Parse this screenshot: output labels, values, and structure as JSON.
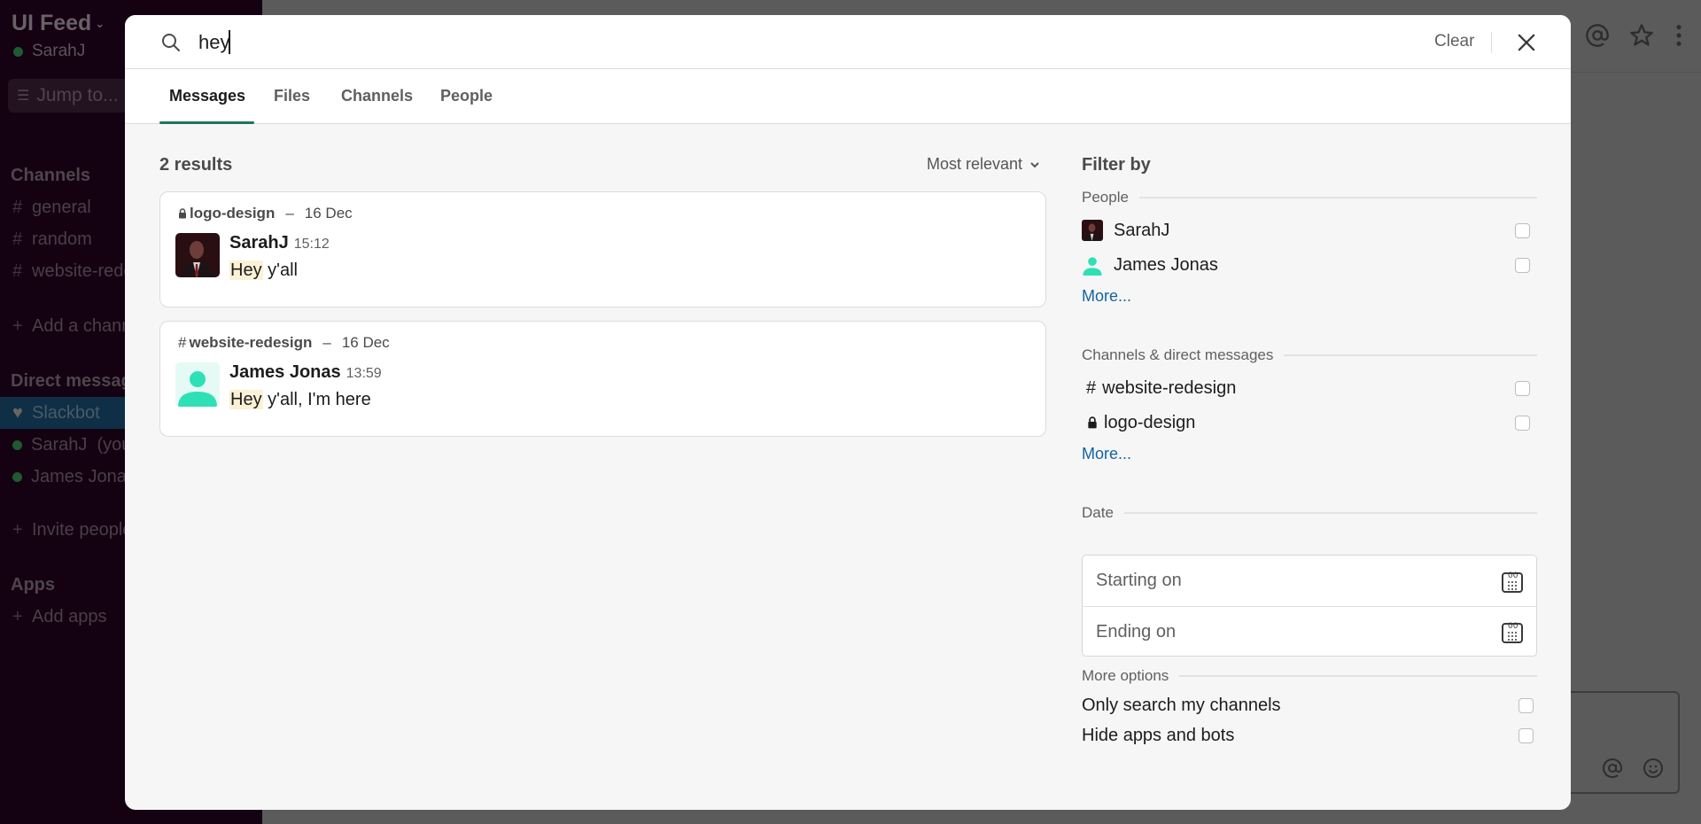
{
  "sidebar": {
    "workspace": "UI Feed",
    "user": "SarahJ",
    "jump_to": "Jump to...",
    "channels_header": "Channels",
    "channels": [
      "general",
      "random",
      "website-redesign"
    ],
    "add_channel": "Add a channel",
    "dm_header": "Direct messages",
    "dms": [
      {
        "name": "Slackbot",
        "suffix": ""
      },
      {
        "name": "SarahJ",
        "suffix": "(you)"
      },
      {
        "name": "James Jonas",
        "suffix": ""
      }
    ],
    "invite": "Invite people",
    "apps_header": "Apps",
    "add_apps": "Add apps"
  },
  "search": {
    "query": "hey",
    "clear_label": "Clear"
  },
  "tabs": [
    {
      "label": "Messages",
      "active": true
    },
    {
      "label": "Files",
      "active": false
    },
    {
      "label": "Channels",
      "active": false
    },
    {
      "label": "People",
      "active": false
    }
  ],
  "results": {
    "count_label": "2 results",
    "sort_label": "Most relevant",
    "items": [
      {
        "channel": "logo-design",
        "channel_type": "private",
        "date": "16 Dec",
        "author": "SarahJ",
        "time": "15:12",
        "highlight": "Hey",
        "rest": " y'all"
      },
      {
        "channel": "website-redesign",
        "channel_type": "public",
        "date": "16 Dec",
        "author": "James Jonas",
        "time": "13:59",
        "highlight": "Hey",
        "rest": " y'all, I'm here"
      }
    ]
  },
  "filter": {
    "title": "Filter by",
    "people_header": "People",
    "people": [
      "SarahJ",
      "James Jonas"
    ],
    "people_more": "More...",
    "channels_header": "Channels & direct messages",
    "channels": [
      "website-redesign",
      "logo-design"
    ],
    "channels_more": "More...",
    "date_header": "Date",
    "starting_placeholder": "Starting on",
    "ending_placeholder": "Ending on",
    "more_options_header": "More options",
    "options": [
      "Only search my channels",
      "Hide apps and bots"
    ]
  },
  "colors": {
    "accent_tab": "#1e7656",
    "link": "#1264a3",
    "highlight": "#fbf1d6",
    "avatar_teal": "#2ee0b5"
  }
}
